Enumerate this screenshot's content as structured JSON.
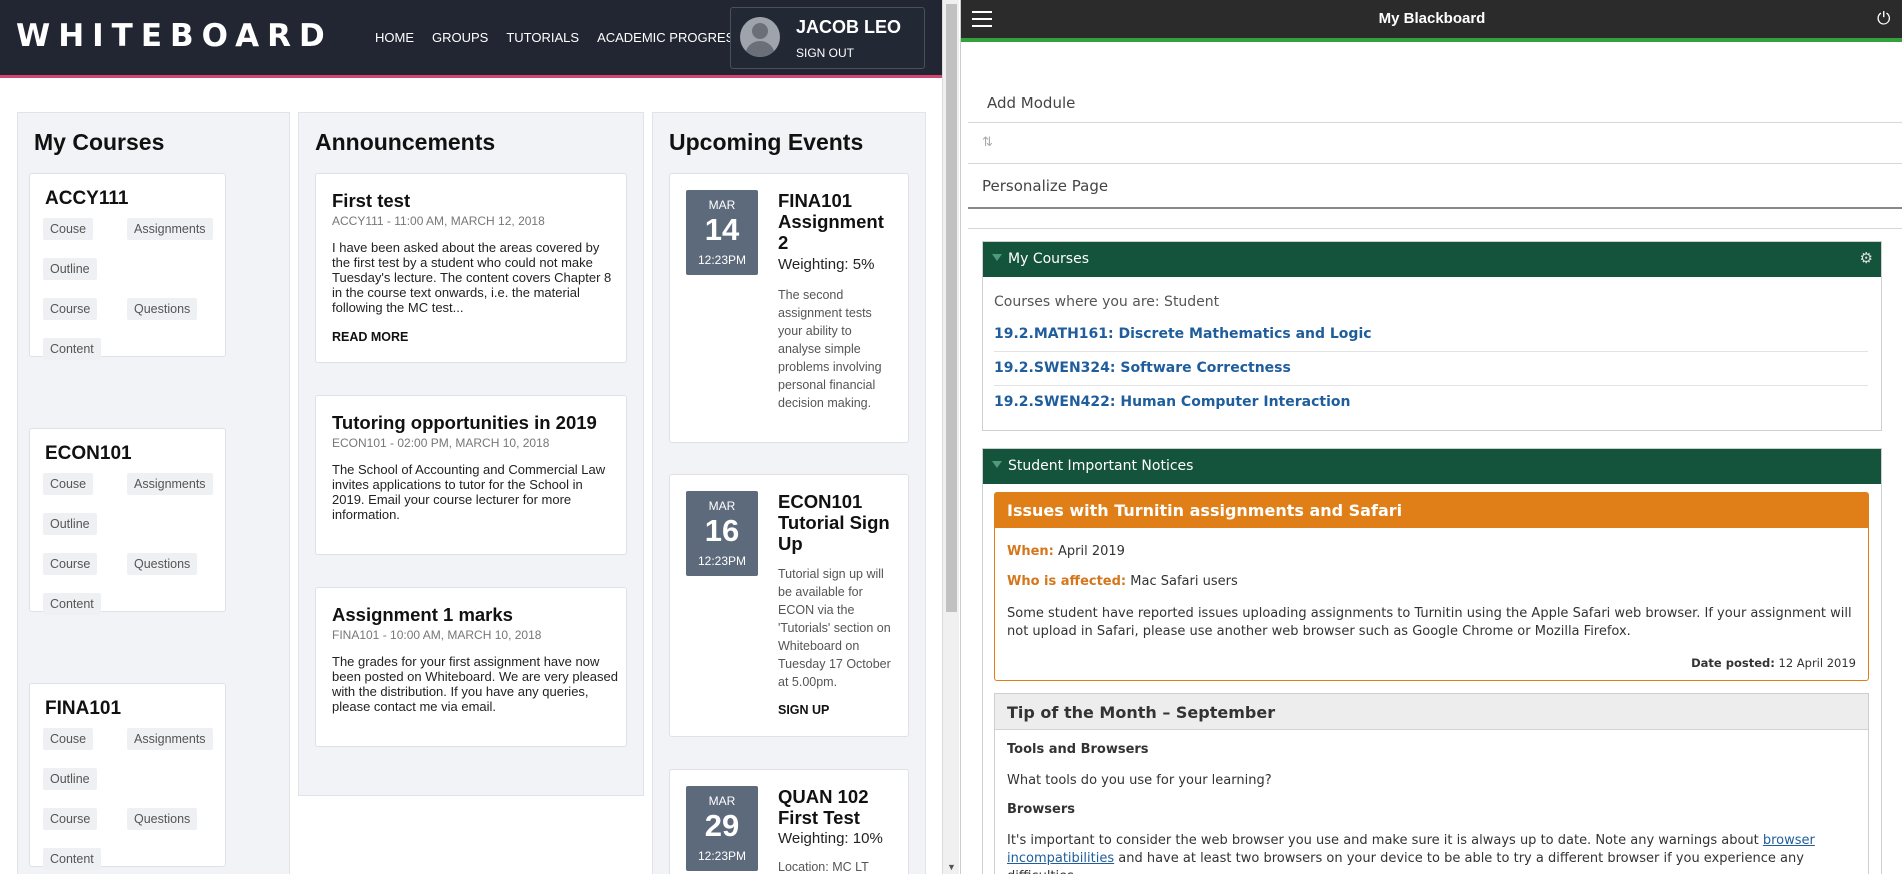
{
  "whiteboard": {
    "logo": "WHITEBOARD",
    "nav": [
      "HOME",
      "GROUPS",
      "TUTORIALS",
      "ACADEMIC PROGRESS"
    ],
    "user": {
      "name": "JACOB LEO",
      "signout": "SIGN OUT"
    },
    "courses": {
      "title": "My Courses",
      "items": [
        {
          "code": "ACCY111",
          "tags": [
            "Couse",
            "Assignments",
            "Outline",
            "Course",
            "Questions",
            "Content"
          ]
        },
        {
          "code": "ECON101",
          "tags": [
            "Couse",
            "Assignments",
            "Outline",
            "Course",
            "Questions",
            "Content"
          ]
        },
        {
          "code": "FINA101",
          "tags": [
            "Couse",
            "Assignments",
            "Outline",
            "Course",
            "Questions",
            "Content"
          ]
        }
      ]
    },
    "announcements": {
      "title": "Announcements",
      "items": [
        {
          "title": "First test",
          "meta": "ACCY111 - 11:00 AM, MARCH 12, 2018",
          "body": "I have been asked about the areas covered by the first test by a student who could not make Tuesday's lecture. The content covers Chapter 8 in the course text onwards, i.e. the material following the MC test...",
          "link": "READ MORE"
        },
        {
          "title": "Tutoring opportunities in 2019",
          "meta": "ECON101 - 02:00 PM, MARCH 10, 2018",
          "body": "The School of Accounting and Commercial Law invites applications to tutor for the School in 2019. Email your course lecturer for more information."
        },
        {
          "title": "Assignment 1 marks",
          "meta": "FINA101 - 10:00 AM, MARCH 10, 2018",
          "body": "The grades for your first assignment have now been posted on Whiteboard. We are very pleased with the distribution. If you have any queries, please contact me via email."
        }
      ]
    },
    "events": {
      "title": "Upcoming Events",
      "items": [
        {
          "month": "MAR",
          "day": "14",
          "time": "12:23PM",
          "title": "FINA101 Assignment 2",
          "weighting": "Weighting: 5%",
          "desc": "The second assignment tests your ability to analyse simple problems involving personal financial decision making."
        },
        {
          "month": "MAR",
          "day": "16",
          "time": "12:23PM",
          "title": "ECON101 Tutorial Sign Up",
          "desc": "Tutorial sign up will be available for ECON via the 'Tutorials' section on Whiteboard on Tuesday 17 October at 5.00pm.",
          "link": "SIGN UP"
        },
        {
          "month": "MAR",
          "day": "29",
          "time": "12:23PM",
          "title": "QUAN 102 First Test",
          "weighting": "Weighting: 10%",
          "desc": "Location: MC LT"
        }
      ]
    }
  },
  "blackboard": {
    "title": "My Blackboard",
    "add_module": "Add Module",
    "reorder": "⇅",
    "personalize": "Personalize Page",
    "my_courses": {
      "title": "My Courses",
      "subtitle": "Courses where you are: Student",
      "links": [
        "19.2.MATH161: Discrete Mathematics and Logic",
        "19.2.SWEN324: Software Correctness",
        "19.2.SWEN422: Human Computer Interaction"
      ]
    },
    "notices": {
      "title": "Student Important Notices",
      "notice": {
        "title": "Issues with Turnitin assignments and Safari",
        "when_label": "When:",
        "when": "April 2019",
        "who_label": "Who is affected:",
        "who": "Mac Safari users",
        "desc": "Some student have reported issues uploading assignments to Turnitin using the Apple Safari web browser. If your assignment will not upload in Safari, please use another web browser such as Google Chrome or Mozilla Firefox.",
        "date_label": "Date posted:",
        "date": "12 April 2019"
      },
      "tip": {
        "title": "Tip of the Month – September",
        "h1": "Tools and Browsers",
        "p1": "What tools do you use for your learning?",
        "h2": "Browsers",
        "p2_a": "It's important to consider the web browser you use and make sure it is always up to date. Note any warnings about ",
        "p2_link": "browser incompatibilities",
        "p2_b": " and have at least two browsers on your device to be able to try a different browser if you experience any difficulties."
      }
    }
  }
}
